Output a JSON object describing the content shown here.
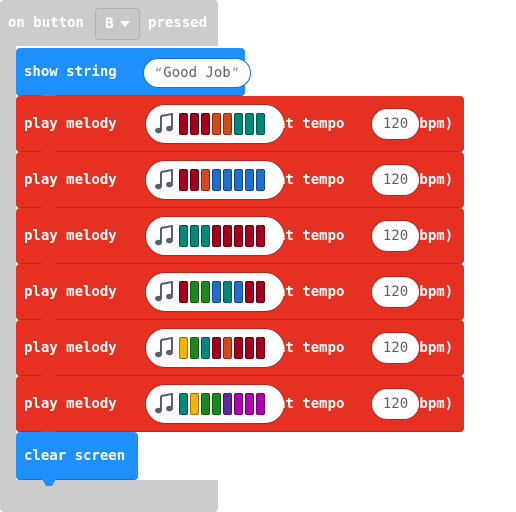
{
  "event": {
    "prefix": "on button",
    "button": "B",
    "suffix": "pressed"
  },
  "show_string": {
    "label": "show string",
    "value": "Good Job"
  },
  "melody_rows": [
    {
      "play_label": "play melody",
      "at_label": "at tempo",
      "tempo": "120",
      "unit": "(bpm)",
      "notes": [
        "#a4001d",
        "#a4001d",
        "#a4001d",
        "#d4481c",
        "#d4481c",
        "#00897b",
        "#00897b",
        "#00897b"
      ]
    },
    {
      "play_label": "play melody",
      "at_label": "at tempo",
      "tempo": "120",
      "unit": "(bpm)",
      "notes": [
        "#a4001d",
        "#a4001d",
        "#d4481c",
        "#1e6fd0",
        "#1e6fd0",
        "#1e6fd0",
        "#1e6fd0",
        "#1e6fd0"
      ]
    },
    {
      "play_label": "play melody",
      "at_label": "at tempo",
      "tempo": "120",
      "unit": "(bpm)",
      "notes": [
        "#00897b",
        "#00897b",
        "#00897b",
        "#a4001d",
        "#a4001d",
        "#a4001d",
        "#a4001d",
        "#a4001d"
      ]
    },
    {
      "play_label": "play melody",
      "at_label": "at tempo",
      "tempo": "120",
      "unit": "(bpm)",
      "notes": [
        "#a4001d",
        "#1b8a1b",
        "#1b8a1b",
        "#1e6fd0",
        "#00897b",
        "#1e6fd0",
        "#a4001d",
        "#a4001d"
      ]
    },
    {
      "play_label": "play melody",
      "at_label": "at tempo",
      "tempo": "120",
      "unit": "(bpm)",
      "notes": [
        "#f2b400",
        "#1b8a1b",
        "#00897b",
        "#a4001d",
        "#d4481c",
        "#a4001d",
        "#a4001d",
        "#a4001d"
      ]
    },
    {
      "play_label": "play melody",
      "at_label": "at tempo",
      "tempo": "120",
      "unit": "(bpm)",
      "notes": [
        "#00897b",
        "#f2b400",
        "#1b8a1b",
        "#1b8a1b",
        "#5b2a9c",
        "#b000b0",
        "#b000b0",
        "#b000b0"
      ]
    }
  ],
  "clear_screen": {
    "label": "clear screen"
  },
  "colors": {
    "hat": "#cccccc",
    "basic_blue": "#1e90ff",
    "music_red": "#e63022"
  }
}
